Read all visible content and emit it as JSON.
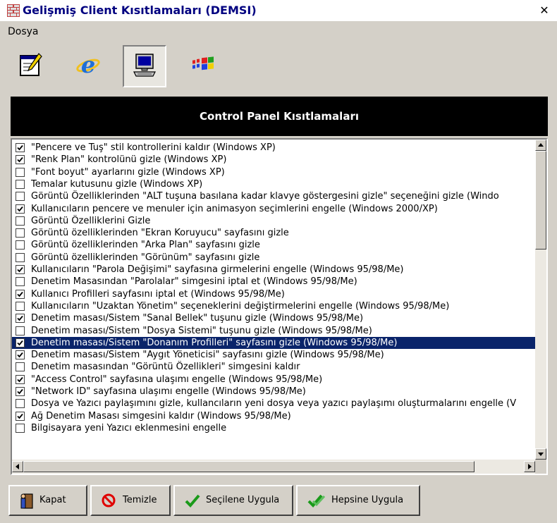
{
  "window": {
    "title": "Gelişmiş Client Kısıtlamaları (DEMSI)",
    "close_label": "✕"
  },
  "menu": {
    "items": [
      {
        "label": "Dosya"
      }
    ]
  },
  "toolbar": {
    "buttons": [
      {
        "icon": "notepad-icon",
        "active": false
      },
      {
        "icon": "internet-explorer-icon",
        "active": false
      },
      {
        "icon": "computer-icon",
        "active": true
      },
      {
        "icon": "windows-flag-icon",
        "active": false
      }
    ]
  },
  "banner": {
    "title": "Control Panel Kısıtlamaları"
  },
  "list": {
    "items": [
      {
        "label": "\"Pencere ve Tuş\" stil kontrollerini kaldır (Windows XP)",
        "checked": true
      },
      {
        "label": "\"Renk Plan\" kontrolünü gizle (Windows XP)",
        "checked": true
      },
      {
        "label": "\"Font boyut\" ayarlarını gizle (Windows XP)",
        "checked": false
      },
      {
        "label": "Temalar kutusunu gizle (Windows XP)",
        "checked": false
      },
      {
        "label": "Görüntü Özelliklerinden \"ALT tuşuna basılana kadar klavye göstergesini gizle\" seçeneğini gizle (Windo",
        "checked": false
      },
      {
        "label": "Kullanıcıların pencere ve menuler için animasyon seçimlerini engelle (Windows 2000/XP)",
        "checked": true
      },
      {
        "label": "Görüntü Özelliklerini Gizle",
        "checked": false
      },
      {
        "label": "Görüntü özelliklerinden \"Ekran Koruyucu\" sayfasını gizle",
        "checked": false
      },
      {
        "label": "Görüntü özelliklerinden \"Arka Plan\" sayfasını gizle",
        "checked": false
      },
      {
        "label": "Görüntü özelliklerinden \"Görünüm\" sayfasını gizle",
        "checked": false
      },
      {
        "label": "Kullanıcıların \"Parola Değişimi\" sayfasına girmelerini engelle (Windows 95/98/Me)",
        "checked": true
      },
      {
        "label": "Denetim Masasından \"Parolalar\" simgesini iptal et (Windows 95/98/Me)",
        "checked": false
      },
      {
        "label": "Kullanıcı Profilleri sayfasını iptal et (Windows 95/98/Me)",
        "checked": true
      },
      {
        "label": "Kullanıcıların \"Uzaktan Yönetim\" seçeneklerini değiştirmelerini engelle (Windows 95/98/Me)",
        "checked": false
      },
      {
        "label": "Denetim masası/Sistem \"Sanal Bellek\" tuşunu gizle (Windows 95/98/Me)",
        "checked": true
      },
      {
        "label": "Denetim masası/Sistem \"Dosya Sistemi\" tuşunu gizle (Windows 95/98/Me)",
        "checked": false
      },
      {
        "label": "Denetim masası/Sistem \"Donanım Profilleri\" sayfasını gizle (Windows 95/98/Me)",
        "checked": true,
        "selected": true
      },
      {
        "label": "Denetim masası/Sistem \"Aygıt Yöneticisi\" sayfasını gizle (Windows 95/98/Me)",
        "checked": true
      },
      {
        "label": "Denetim masasından \"Görüntü Özellikleri\" simgesini kaldır",
        "checked": false
      },
      {
        "label": "\"Access Control\" sayfasına ulaşımı engelle (Windows 95/98/Me)",
        "checked": true
      },
      {
        "label": "\"Network ID\" sayfasına ulaşımı engelle (Windows 95/98/Me)",
        "checked": true
      },
      {
        "label": "Dosya ve Yazıcı paylaşımını gizle, kullancıların yeni dosya veya yazıcı paylaşımı oluşturmalarını engelle (V",
        "checked": false
      },
      {
        "label": "Ağ Denetim Masası simgesini kaldır (Windows 95/98/Me)",
        "checked": true
      },
      {
        "label": "Bilgisayara yeni Yazıcı eklenmesini engelle",
        "checked": false
      }
    ]
  },
  "scroll": {
    "vertical_position": 0.0,
    "horizontal_position": 0.0
  },
  "footer": {
    "buttons": [
      {
        "label": "Kapat",
        "icon": "exit-door-icon"
      },
      {
        "label": "Temizle",
        "icon": "no-sign-icon"
      },
      {
        "label": "Seçilene Uygula",
        "icon": "checkmark-icon"
      },
      {
        "label": "Hepsine Uygula",
        "icon": "double-checkmark-icon"
      }
    ]
  },
  "colors": {
    "title_text": "#000080",
    "selection": "#0a246a",
    "face": "#d4d0c8",
    "banner": "#000000"
  }
}
